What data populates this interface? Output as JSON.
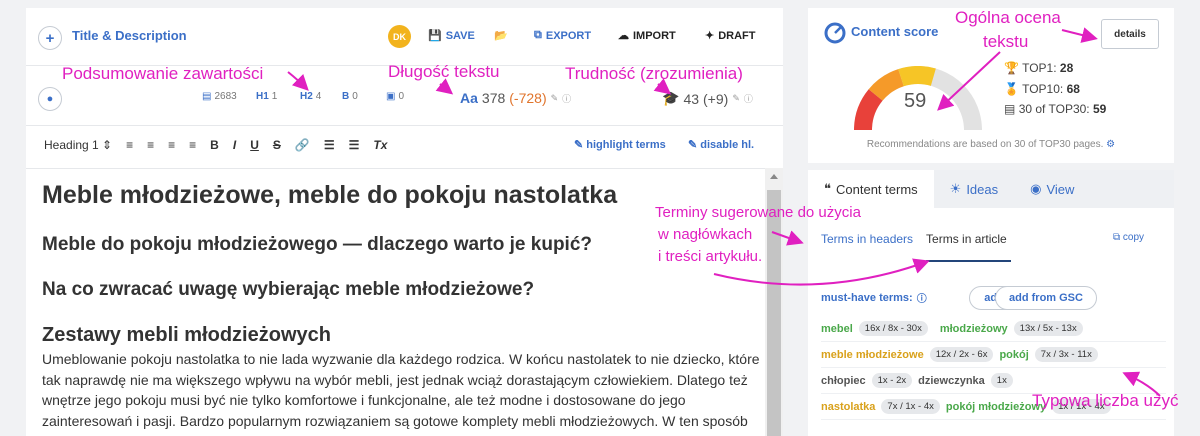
{
  "editor": {
    "title_desc": "Title & Description",
    "avatar": "DK",
    "save": "SAVE",
    "export": "EXPORT",
    "import": "IMPORT",
    "draft": "DRAFT",
    "stats": {
      "words": "2683",
      "h1_label": "H1",
      "h1": "1",
      "h2_label": "H2",
      "h2": "4",
      "b_label": "B",
      "b": "0",
      "img": "0",
      "length_ic": "Aa",
      "length": "378",
      "length_delta": "(-728)",
      "difficulty": "43",
      "difficulty_delta": "(+9)"
    },
    "format": {
      "heading": "Heading 1",
      "bold": "B",
      "italic": "I",
      "underline": "U",
      "strike": "S",
      "clear": "Tx",
      "highlight": "highlight terms",
      "disable": "disable hl."
    },
    "content": {
      "h1": "Meble młodzieżowe, meble do pokoju nastolatka",
      "h2a": "Meble do pokoju młodzieżowego — dlaczego warto je kupić?",
      "h2b": "Na co zwracać uwagę wybierając meble młodzieżowe?",
      "h3": "Zestawy mebli młodzieżowych",
      "para": "Umeblowanie pokoju nastolatka to nie lada wyzwanie dla każdego rodzica. W końcu nastolatek to nie dziecko, które tak naprawdę nie ma większego wpływu na wybór mebli, jest jednak wciąż dorastającym człowiekiem. Dlatego też wnętrze jego pokoju musi być nie tylko komfortowe i funkcjonalne, ale też modne i dostosowane do jego zainteresowań i pasji. Bardzo popularnym rozwiązaniem są gotowe komplety mebli młodzieżowych. W ten sposób nie trzeba dobierać wszystkich elementów osobno, dbać o odpowiednią kompozycję czy połączenia."
    }
  },
  "score": {
    "title": "Content score",
    "details": "details",
    "value": "59",
    "gauge_fraction": 0.59,
    "top1_label": "TOP1:",
    "top1": "28",
    "top10_label": "TOP10:",
    "top10": "68",
    "top30_label": "30 of TOP30:",
    "top30": "59",
    "note": "Recommendations are based on 30 of TOP30 pages."
  },
  "terms_panel": {
    "tabs": [
      "Content terms",
      "Ideas",
      "View"
    ],
    "subtabs": [
      "Terms in headers",
      "Terms in article"
    ],
    "copy": "copy",
    "must_have": "must-have terms:",
    "add": "add",
    "add_gsc": "add from GSC",
    "rows": [
      [
        {
          "term": "mebel",
          "count": "16x / 8x - 30x",
          "color": "green"
        },
        {
          "term": "młodzieżowy",
          "count": "13x / 5x - 13x",
          "color": "green"
        }
      ],
      [
        {
          "term": "meble młodzieżowe",
          "count": "12x / 2x - 6x",
          "color": "orange"
        },
        {
          "term": "pokój",
          "count": "7x / 3x - 11x",
          "color": "green"
        }
      ],
      [
        {
          "term": "chłopiec",
          "count": "1x - 2x",
          "color": "gray"
        },
        {
          "term": "dziewczynka",
          "count": "1x",
          "color": "gray"
        }
      ],
      [
        {
          "term": "nastolatka",
          "count": "7x / 1x - 4x",
          "color": "orange"
        },
        {
          "term": "pokój młodzieżowy",
          "count": "1x / 1x - 4x",
          "color": "green"
        }
      ]
    ]
  },
  "annotations": {
    "summary": "Podsumowanie zawartości",
    "length": "Długość tekstu",
    "difficulty": "Trudność (zrozumienia)",
    "overall1": "Ogólna ocena",
    "overall2": "tekstu",
    "suggest1": "Terminy sugerowane do użycia",
    "suggest2": "w nagłówkach",
    "suggest3": "i treści artykułu.",
    "typical": "Typowa liczba użyć"
  },
  "colors": {
    "accent": "#3b6fc7",
    "annotation": "#e020c0",
    "warning": "#e0742c",
    "avatar": "#f2b31d"
  }
}
